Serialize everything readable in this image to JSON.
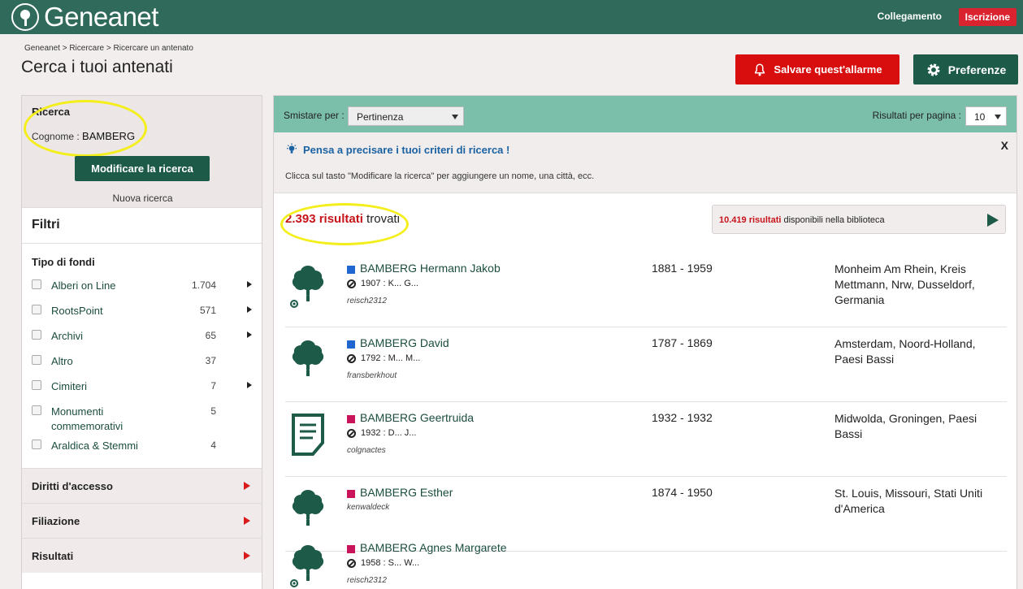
{
  "brand": {
    "name": "Geneanet",
    "logo_icon": "tree-circle-icon"
  },
  "header": {
    "login": "Collegamento",
    "signup": "Iscrizione"
  },
  "breadcrumb": "Geneanet > Ricercare > Ricercare un antenato",
  "page_title": "Cerca i tuoi antenati",
  "actions": {
    "alarm": "Salvare quest'allarme",
    "preferences": "Preferenze"
  },
  "search": {
    "title": "Ricerca",
    "surname_label": "Cognome : ",
    "surname_value": "BAMBERG",
    "modify": "Modificare la ricerca",
    "new_search": "Nuova ricerca"
  },
  "filters": {
    "title": "Filtri",
    "fund_type_title": "Tipo di fondi",
    "funds": [
      {
        "label": "Alberi on Line",
        "count": "1.704",
        "has_arrow": true
      },
      {
        "label": "RootsPoint",
        "count": "571",
        "has_arrow": true
      },
      {
        "label": "Archivi",
        "count": "65",
        "has_arrow": true
      },
      {
        "label": "Altro",
        "count": "37",
        "has_arrow": false
      },
      {
        "label": "Cimiteri",
        "count": "7",
        "has_arrow": true
      },
      {
        "label": "Monumenti commemorativi",
        "count": "5",
        "has_arrow": false
      },
      {
        "label": "Araldica & Stemmi",
        "count": "4",
        "has_arrow": false
      }
    ],
    "accordions": [
      "Diritti d'accesso",
      "Filiazione",
      "Risultati"
    ]
  },
  "toolbar": {
    "sort_label": "Smistare per :",
    "sort_value": "Pertinenza",
    "per_page_label": "Risultati per pagina :",
    "per_page_value": "10"
  },
  "tip": {
    "title": "Pensa a precisare i tuoi criteri di ricerca !",
    "text": "Clicca sul tasto \"Modificare la ricerca\" per aggiungere un nome, una città, ecc.",
    "close": "X"
  },
  "results": {
    "count": "2.393 risultati",
    "count_suffix": " trovati",
    "library_count": "10.419 risultati",
    "library_suffix": " disponibili nella biblioteca",
    "items": [
      {
        "name": "BAMBERG Hermann Jakob",
        "gender_color": "#1f66d1",
        "birth": "1907 : K... G...",
        "user": "reisch2312",
        "years": "1881 - 1959",
        "place": "Monheim Am Rhein, Kreis Mettmann, Nrw, Dusseldorf, Germania",
        "icon": "tree-icon"
      },
      {
        "name": "BAMBERG David",
        "gender_color": "#1f66d1",
        "birth": "1792 : M... M...",
        "user": "fransberkhout",
        "years": "1787 - 1869",
        "place": "Amsterdam, Noord-Holland, Paesi Bassi",
        "icon": "tree-icon"
      },
      {
        "name": "BAMBERG Geertruida",
        "gender_color": "#c8145a",
        "birth": "1932 : D... J...",
        "user": "colgnactes",
        "years": "1932 - 1932",
        "place": "Midwolda, Groningen, Paesi Bassi",
        "icon": "document-icon"
      },
      {
        "name": "BAMBERG Esther",
        "gender_color": "#c8145a",
        "birth": "",
        "user": "kenwaldeck",
        "years": "1874 - 1950",
        "place": "St. Louis, Missouri, Stati Uniti d'America",
        "icon": "tree-icon"
      },
      {
        "name": "BAMBERG Agnes Margarete",
        "gender_color": "#c8145a",
        "birth": "1958 : S... W...",
        "user": "reisch2312",
        "years": "",
        "place": "",
        "icon": "tree-icon"
      }
    ]
  }
}
